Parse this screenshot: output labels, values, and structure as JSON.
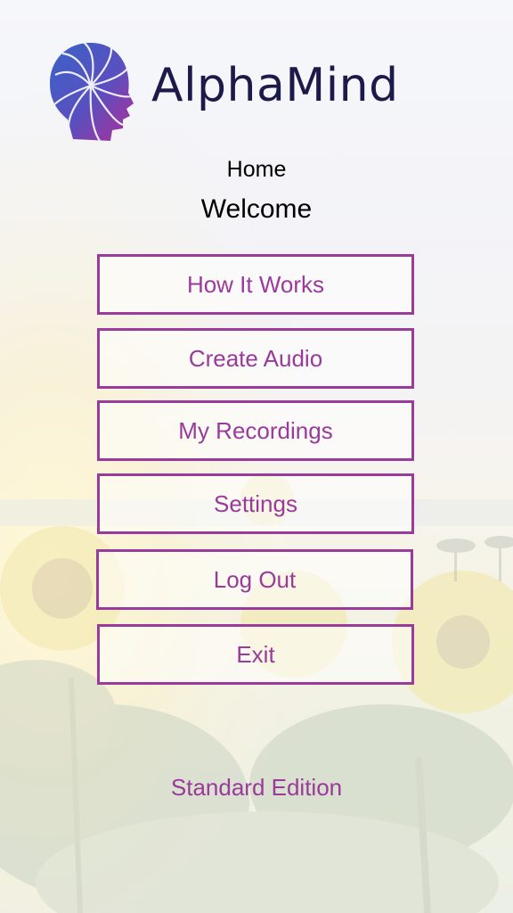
{
  "app": {
    "title": "AlphaMind"
  },
  "header": {
    "breadcrumb": "Home",
    "greeting": "Welcome"
  },
  "menu": [
    {
      "label": "How It Works",
      "name": "how-it-works-button"
    },
    {
      "label": "Create Audio",
      "name": "create-audio-button"
    },
    {
      "label": "My Recordings",
      "name": "my-recordings-button"
    },
    {
      "label": "Settings",
      "name": "settings-button"
    },
    {
      "label": "Log Out",
      "name": "log-out-button"
    },
    {
      "label": "Exit",
      "name": "exit-button"
    }
  ],
  "footer": {
    "edition": "Standard Edition"
  },
  "colors": {
    "accent": "#9a3a9a",
    "brand_text": "#1c1a4a",
    "logo_blue": "#3a63c8",
    "logo_purple": "#a8309a"
  },
  "icons": {
    "logo": "head-spiral-logo-icon"
  }
}
